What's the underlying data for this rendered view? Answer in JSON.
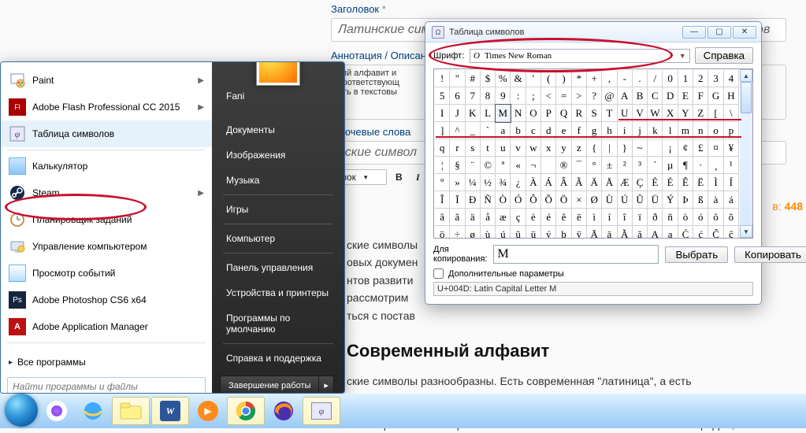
{
  "bg": {
    "title_label": "Заголовок",
    "title_value": "Латинские символы - как напечатать на компьютере? Обзор способов",
    "anno_label": "Аннотация / Описание",
    "anno_frag1": "кий алфавит и",
    "anno_frag2": "соответствующ",
    "anno_frag3": "ять в текстовы",
    "keywords_label": "Ключевые слова",
    "keywords_frag": "нские символ",
    "sel1": "овок",
    "h2": "Современный алфавит",
    "p1_frag": "ские символы\nовых докумен\nнтов развити\nрассмотрим\nться с постав",
    "p2": "ские символы разнообразны. Есть современная \"латиница\", а есть\n. В зависимости от вида знаков будет меняться способ их написания.",
    "p3": "м с современного алфавита. Чтобы написать латинские символы и цифры,",
    "views_prefix": "в: ",
    "views_count": "448"
  },
  "start": {
    "left": [
      {
        "label": "Paint",
        "arrow": true,
        "ico": "paint"
      },
      {
        "label": "Adobe Flash Professional CC 2015",
        "arrow": true,
        "ico": "fl"
      },
      {
        "label": "Таблица символов",
        "arrow": false,
        "ico": "charmap",
        "hl": true
      },
      {
        "label": "Калькулятор",
        "arrow": false,
        "ico": "calc"
      },
      {
        "label": "Steam",
        "arrow": true,
        "ico": "steam"
      },
      {
        "label": "Планировщик заданий",
        "arrow": false,
        "ico": "clock"
      },
      {
        "label": "Управление компьютером",
        "arrow": false,
        "ico": "mgmt"
      },
      {
        "label": "Просмотр событий",
        "arrow": false,
        "ico": "event"
      },
      {
        "label": "Adobe Photoshop CS6 x64",
        "arrow": false,
        "ico": "ps"
      },
      {
        "label": "Adobe Application Manager",
        "arrow": false,
        "ico": "am"
      }
    ],
    "all_programs": "Все программы",
    "search_ph": "Найти программы и файлы",
    "user": "Fani",
    "right": [
      "Документы",
      "Изображения",
      "Музыка",
      "Игры",
      "Компьютер",
      "Панель управления",
      "Устройства и принтеры",
      "Программы по умолчанию",
      "Справка и поддержка"
    ],
    "shutdown": "Завершение работы"
  },
  "charmap": {
    "title": "Таблица символов",
    "font_label": "Шрифт:",
    "font_name": "Times New Roman",
    "help": "Справка",
    "copy_label": "Для копирования:",
    "copy_value": "M",
    "select": "Выбрать",
    "copy": "Копировать",
    "extra": "Дополнительные параметры",
    "status": "U+004D: Latin Capital Letter M",
    "rows": [
      [
        "!",
        "\"",
        "#",
        "$",
        "%",
        "&",
        "'",
        "(",
        ")",
        "*",
        "+",
        ",",
        "-",
        ".",
        "/",
        "0",
        "1",
        "2",
        "3",
        "4"
      ],
      [
        "5",
        "6",
        "7",
        "8",
        "9",
        ":",
        ";",
        "<",
        "=",
        ">",
        "?",
        "@",
        "A",
        "B",
        "C",
        "D",
        "E",
        "F",
        "G",
        "H"
      ],
      [
        "I",
        "J",
        "K",
        "L",
        "M",
        "N",
        "O",
        "P",
        "Q",
        "R",
        "S",
        "T",
        "U",
        "V",
        "W",
        "X",
        "Y",
        "Z",
        "[",
        "\\"
      ],
      [
        "]",
        "^",
        "_",
        "`",
        "a",
        "b",
        "c",
        "d",
        "e",
        "f",
        "g",
        "h",
        "i",
        "j",
        "k",
        "l",
        "m",
        "n",
        "o",
        "p"
      ],
      [
        "q",
        "r",
        "s",
        "t",
        "u",
        "v",
        "w",
        "x",
        "y",
        "z",
        "{",
        "|",
        "}",
        "~",
        "",
        "¡",
        "¢",
        "£",
        "¤",
        "¥"
      ],
      [
        "¦",
        "§",
        "¨",
        "©",
        "ª",
        "«",
        "¬",
        "­",
        "®",
        "¯",
        "°",
        "±",
        "²",
        "³",
        "´",
        "µ",
        "¶",
        "·",
        "¸",
        "¹"
      ],
      [
        "º",
        "»",
        "¼",
        "½",
        "¾",
        "¿",
        "À",
        "Á",
        "Â",
        "Ã",
        "Ä",
        "Å",
        "Æ",
        "Ç",
        "È",
        "É",
        "Ê",
        "Ë",
        "Ì",
        "Í"
      ],
      [
        "Î",
        "Ï",
        "Ð",
        "Ñ",
        "Ò",
        "Ó",
        "Ô",
        "Õ",
        "Ö",
        "×",
        "Ø",
        "Ù",
        "Ú",
        "Û",
        "Ü",
        "Ý",
        "Þ",
        "ß",
        "à",
        "á"
      ],
      [
        "â",
        "ã",
        "ä",
        "å",
        "æ",
        "ç",
        "è",
        "é",
        "ê",
        "ë",
        "ì",
        "í",
        "î",
        "ï",
        "ð",
        "ñ",
        "ò",
        "ó",
        "ô",
        "õ"
      ],
      [
        "ö",
        "÷",
        "ø",
        "ù",
        "ú",
        "û",
        "ü",
        "ý",
        "þ",
        "ÿ",
        "Ā",
        "ā",
        "Ă",
        "ă",
        "Ą",
        "ą",
        "Ć",
        "ć",
        "Ĉ",
        "ĉ"
      ]
    ],
    "sel_row": 2,
    "sel_col": 4
  }
}
